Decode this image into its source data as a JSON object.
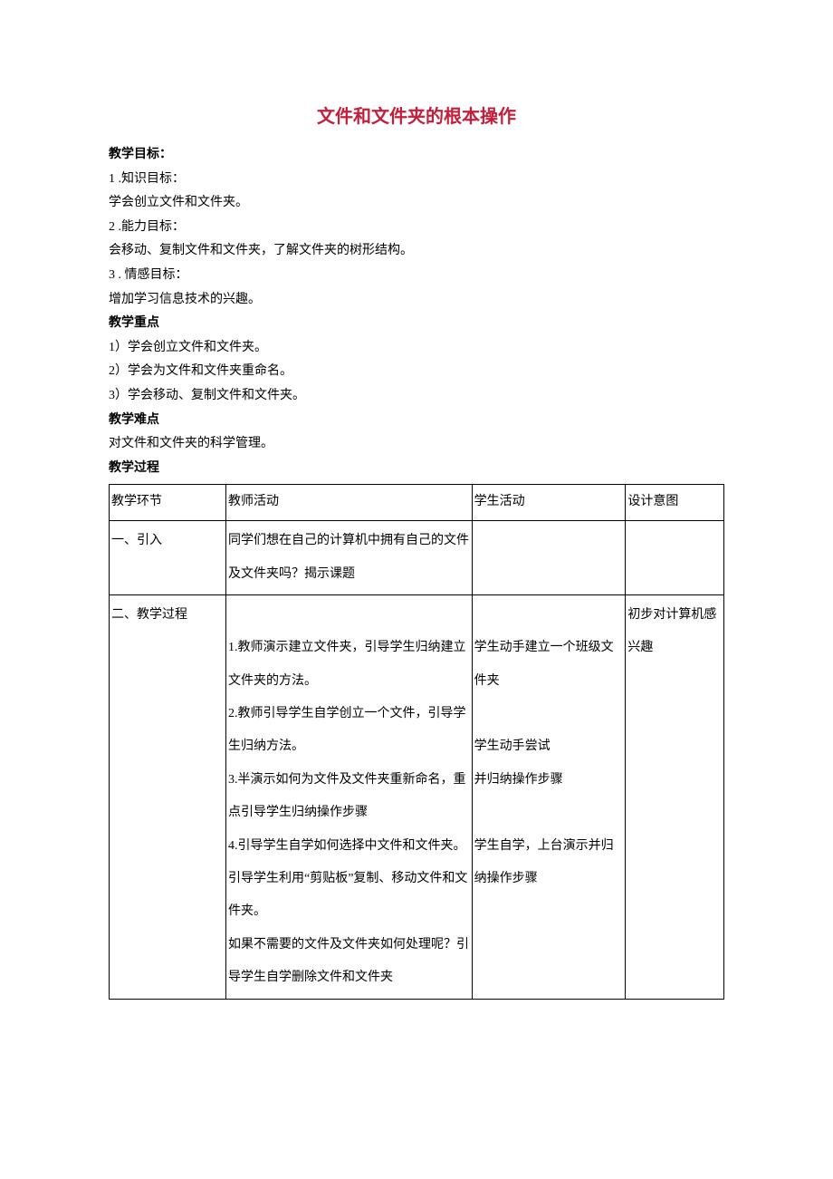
{
  "title": "文件和文件夹的根本操作",
  "goals": {
    "heading": "教学目标：",
    "item1_num": "1 .知识目标：",
    "item1_text": "学会创立文件和文件夹。",
    "item2_num": "2 .能力目标：",
    "item2_text": "会移动、复制文件和文件夹，了解文件夹的树形结构。",
    "item3_num": "3 . 情感目标：",
    "item3_text": "增加学习信息技术的兴趣。"
  },
  "key": {
    "heading": "教学重点",
    "item1": "1）学会创立文件和文件夹。",
    "item2": "2）学会为文件和文件夹重命名。",
    "item3": "3）学会移动、复制文件和文件夹。"
  },
  "difficulty": {
    "heading": "教学难点",
    "text": "对文件和文件夹的科学管理。"
  },
  "process_heading": "教学过程",
  "table": {
    "headers": [
      "教学环节",
      "教师活动",
      "学生活动",
      "设计意图"
    ],
    "rows": [
      {
        "segment": "一、引入",
        "teacher": "同学们想在自己的计算机中拥有自己的文件及文件夹吗？揭示课题",
        "student": "",
        "design": ""
      },
      {
        "segment": "二、教学过程",
        "teacher": "\n1.教师演示建立文件夹，引导学生归纳建立文件夹的方法。\n2.教师引导学生自学创立一个文件，引导学生归纳方法。\n3.半演示如何为文件及文件夹重新命名，重点引导学生归纳操作步骤\n4.引导学生自学如何选择中文件和文件夹。\n引导学生利用“剪贴板”复制、移动文件和文件夹。\n如果不需要的文件及文件夹如何处理呢？引导学生自学删除文件和文件夹",
        "student": "\n学生动手建立一个班级文件夹\n\n学生动手尝试\n并归纳操作步骤\n\n学生自学，上台演示并归纳操作步骤",
        "design": "初步对计算机感兴趣"
      }
    ]
  }
}
